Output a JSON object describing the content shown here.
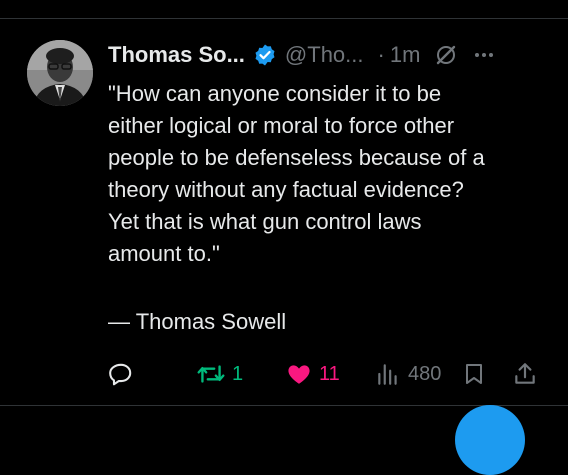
{
  "author": {
    "name": "Thomas So...",
    "handle": "@Tho...",
    "separator": "·",
    "time": "1m",
    "verified": true
  },
  "tweet": {
    "text": "\"How can anyone consider it to be\neither logical or moral to force other\npeople to be defenseless because of a\ntheory without any factual evidence?\nYet that is what gun control laws\namount to.\"",
    "attribution": "— Thomas Sowell"
  },
  "actions": {
    "replies": "",
    "reposts": "1",
    "likes": "11",
    "views": "480"
  },
  "colors": {
    "background": "#000000",
    "text": "#e7e9ea",
    "muted": "#71767b",
    "verified": "#1d9bf0",
    "repost_active": "#00ba7c",
    "like_active": "#f91880"
  },
  "icons": {
    "verified": "verified-badge-icon",
    "grok": "grok-icon",
    "more": "more-icon",
    "reply": "reply-icon",
    "repost": "repost-icon",
    "like": "heart-icon",
    "views": "views-icon",
    "bookmark": "bookmark-icon",
    "share": "share-icon"
  }
}
